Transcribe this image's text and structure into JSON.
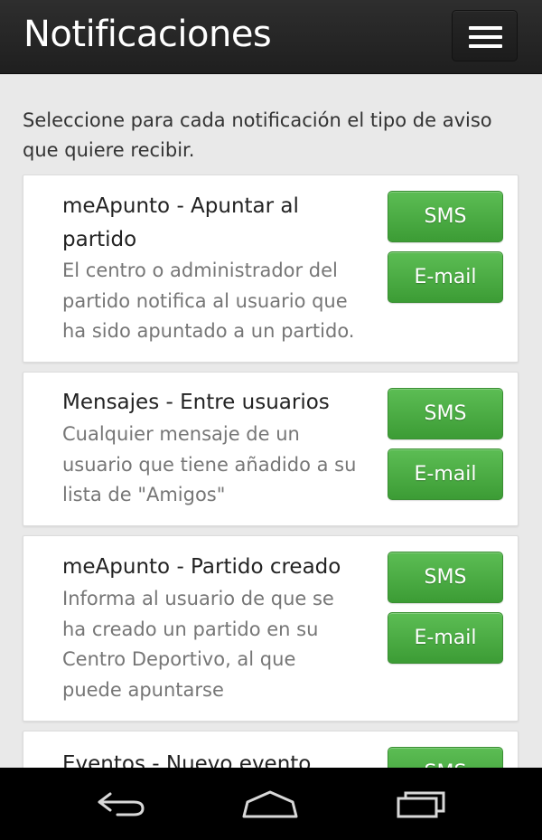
{
  "header": {
    "title": "Notificaciones",
    "menu_icon": "hamburger-menu-icon"
  },
  "intro": "Seleccione para cada notificación el tipo de aviso que quiere recibir.",
  "cards": [
    {
      "title": "meApunto - Apuntar al partido",
      "description": "El centro o administrador del partido notifica al usuario que ha sido apuntado a un partido.",
      "sms_label": "SMS",
      "email_label": "E-mail"
    },
    {
      "title": "Mensajes - Entre usuarios",
      "description": "Cualquier mensaje de un usuario que tiene añadido a su lista de \"Amigos\"",
      "sms_label": "SMS",
      "email_label": "E-mail"
    },
    {
      "title": "meApunto - Partido creado",
      "description": "Informa al usuario de que se ha creado un partido en su Centro Deportivo, al que puede apuntarse",
      "sms_label": "SMS",
      "email_label": "E-mail"
    },
    {
      "title": "Eventos - Nuevo evento",
      "sms_label": "SMS"
    }
  ],
  "navbar": {
    "back_icon": "back-icon",
    "home_icon": "home-icon",
    "recents_icon": "recent-apps-icon"
  },
  "colors": {
    "header_bg": "#252525",
    "page_bg": "#e9e9e9",
    "button_green": "#4cae45",
    "card_bg": "#ffffff",
    "navbar_bg": "#000000"
  }
}
